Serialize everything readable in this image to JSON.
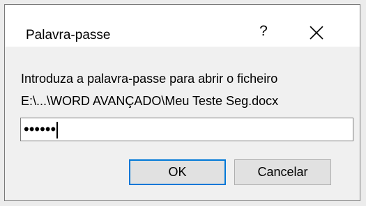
{
  "dialog": {
    "title": "Palavra-passe",
    "help_label": "?",
    "message": "Introduza a palavra-passe para abrir o ficheiro",
    "file_path": "E:\\...\\WORD AVANÇADO\\Meu Teste Seg.docx",
    "password_masked": "••••••",
    "ok_label": "OK",
    "cancel_label": "Cancelar",
    "accent_color": "#0078d7"
  }
}
